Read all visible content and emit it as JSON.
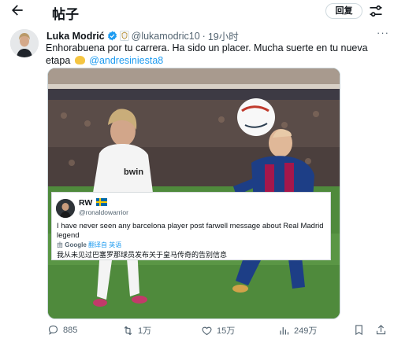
{
  "header": {
    "title": "帖子",
    "reply_button": "回复",
    "icons": {
      "back": "arrow-left-icon",
      "adjust": "adjust-icon"
    }
  },
  "tweet": {
    "author_name": "Luka Modrić",
    "handle": "@lukamodric10",
    "separator": "·",
    "time": "19小时",
    "text_line1": "Enhorabuena por tu carrera. Ha sido un placer. Mucha suerte en tu nueva",
    "text_word": "etapa",
    "mention": "@andresiniesta8",
    "more": "···"
  },
  "quote": {
    "name": "RW",
    "handle": "@ronaldowarrior",
    "text": "I have never seen any barcelona player post farwell message about Real Madrid legend",
    "translated_by": "由",
    "translator": "Google",
    "translated_label": "翻译自 英语",
    "translation": "我从未见过巴塞罗那球员发布关于皇马传奇的告别信息"
  },
  "actions": {
    "replies": "885",
    "retweets": "1万",
    "likes": "15万",
    "views": "249万"
  },
  "colors": {
    "accent": "#1d9bf0",
    "muted": "#536471",
    "text": "#0f1419"
  }
}
